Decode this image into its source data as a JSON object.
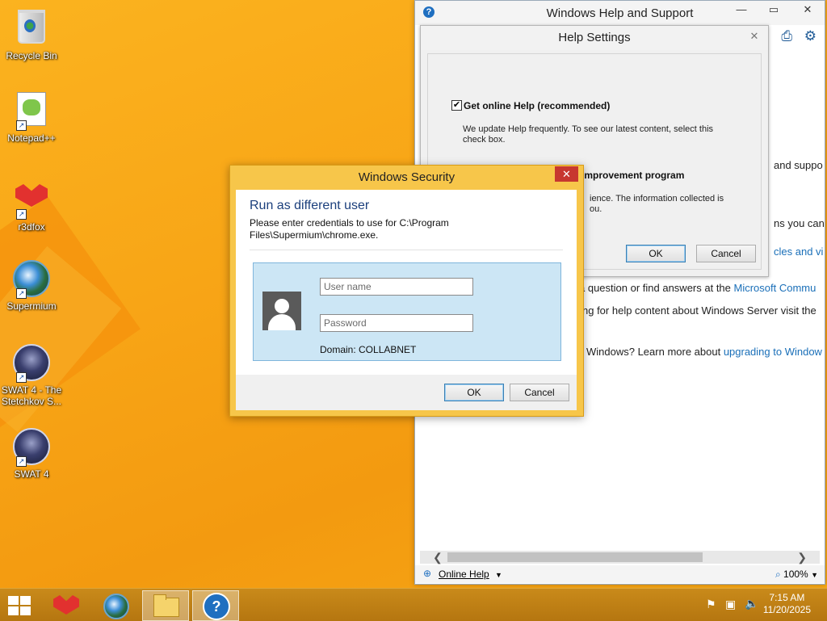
{
  "desktop": {
    "icons": [
      {
        "label": "Recycle Bin"
      },
      {
        "label": "Notepad++"
      },
      {
        "label": "r3dfox"
      },
      {
        "label": "Supermium"
      },
      {
        "label": "SWAT 4 - The Stetchkov S..."
      },
      {
        "label": "SWAT 4"
      }
    ]
  },
  "help_window": {
    "title": "Windows Help and Support",
    "lines": [
      {
        "text": "and suppo"
      },
      {
        "text": "ns you can"
      },
      {
        "text": "cles and vi"
      },
      {
        "prefix": "a question or find answers at the ",
        "link": "Microsoft Commu"
      },
      {
        "text": "ng for help content about Windows Server visit the"
      },
      {
        "prefix": "Windows? Learn more about ",
        "link": "upgrading to Window"
      }
    ],
    "status": {
      "online_help": "Online Help",
      "zoom": "100%"
    }
  },
  "help_settings": {
    "title": "Help Settings",
    "option1": {
      "label": "Get online Help (recommended)",
      "checked": true,
      "description": "We update Help frequently. To see our latest content, select this check box."
    },
    "option2": {
      "label": "Join the Help Experience Improvement program",
      "checked": false,
      "desc_line1": "ience. The information collected is",
      "desc_line2": "ou."
    },
    "ok": "OK",
    "cancel": "Cancel"
  },
  "security_dialog": {
    "title": "Windows Security",
    "heading": "Run as different user",
    "subtext": "Please enter credentials to use for C:\\Program Files\\Supermium\\chrome.exe.",
    "username_placeholder": "User name",
    "password_placeholder": "Password",
    "domain": "Domain: COLLABNET",
    "ok": "OK",
    "cancel": "Cancel"
  },
  "taskbar": {
    "clock_time": "7:15 AM",
    "clock_date": "11/20/2025"
  }
}
